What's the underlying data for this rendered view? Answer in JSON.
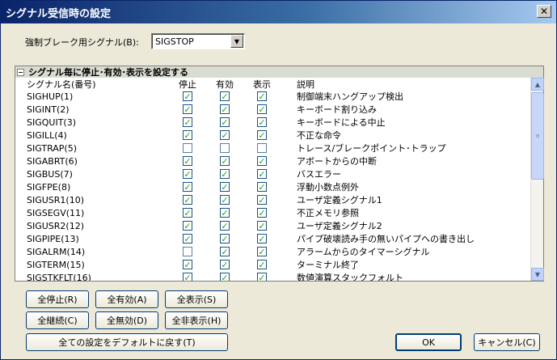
{
  "window": {
    "title": "シグナル受信時の設定",
    "close_label": "✕"
  },
  "brake": {
    "label": "強制ブレーク用シグナル(B):",
    "value": "SIGSTOP",
    "arrow": "▼"
  },
  "group": {
    "toggle": "−",
    "title": "シグナル毎に停止･有効･表示を設定する",
    "headers": {
      "name": "シグナル名(番号)",
      "stop": "停止",
      "enable": "有効",
      "show": "表示",
      "desc": "説明"
    }
  },
  "signals": [
    {
      "name": "SIGHUP(1)",
      "stop": true,
      "enable": true,
      "show": true,
      "desc": "制御端末ハングアップ検出"
    },
    {
      "name": "SIGINT(2)",
      "stop": true,
      "enable": true,
      "show": true,
      "desc": "キーボード割り込み"
    },
    {
      "name": "SIGQUIT(3)",
      "stop": true,
      "enable": true,
      "show": true,
      "desc": "キーボードによる中止"
    },
    {
      "name": "SIGILL(4)",
      "stop": true,
      "enable": true,
      "show": true,
      "desc": "不正な命令"
    },
    {
      "name": "SIGTRAP(5)",
      "stop": false,
      "enable": false,
      "show": false,
      "desc": "トレース/ブレークポイント･トラップ"
    },
    {
      "name": "SIGABRT(6)",
      "stop": true,
      "enable": true,
      "show": true,
      "desc": "アボートからの中断"
    },
    {
      "name": "SIGBUS(7)",
      "stop": true,
      "enable": true,
      "show": true,
      "desc": "バスエラー"
    },
    {
      "name": "SIGFPE(8)",
      "stop": true,
      "enable": true,
      "show": true,
      "desc": "浮動小数点例外"
    },
    {
      "name": "SIGUSR1(10)",
      "stop": true,
      "enable": true,
      "show": true,
      "desc": "ユーザ定義シグナル1"
    },
    {
      "name": "SIGSEGV(11)",
      "stop": true,
      "enable": true,
      "show": true,
      "desc": "不正メモリ参照"
    },
    {
      "name": "SIGUSR2(12)",
      "stop": true,
      "enable": true,
      "show": true,
      "desc": "ユーザ定義シグナル2"
    },
    {
      "name": "SIGPIPE(13)",
      "stop": true,
      "enable": true,
      "show": true,
      "desc": "パイプ破壊読み手の無いパイプへの書き出し"
    },
    {
      "name": "SIGALRM(14)",
      "stop": false,
      "enable": true,
      "show": true,
      "desc": "アラームからのタイマーシグナル"
    },
    {
      "name": "SIGTERM(15)",
      "stop": true,
      "enable": true,
      "show": true,
      "desc": "ターミナル終了"
    },
    {
      "name": "SIGSTKFLT(16)",
      "stop": true,
      "enable": true,
      "show": true,
      "desc": "数値演算スタックフォルト"
    }
  ],
  "check_mark": "✓",
  "scrollbar": {
    "up": "▲",
    "down": "▼",
    "grip": "≡"
  },
  "buttons": {
    "stop_all": "全停止(R)",
    "enable_all": "全有効(A)",
    "show_all": "全表示(S)",
    "continue_all": "全継続(C)",
    "disable_all": "全無効(D)",
    "hide_all": "全非表示(H)",
    "reset": "全ての設定をデフォルトに戻す(T)",
    "ok": "OK",
    "cancel": "キャンセル(C)"
  }
}
